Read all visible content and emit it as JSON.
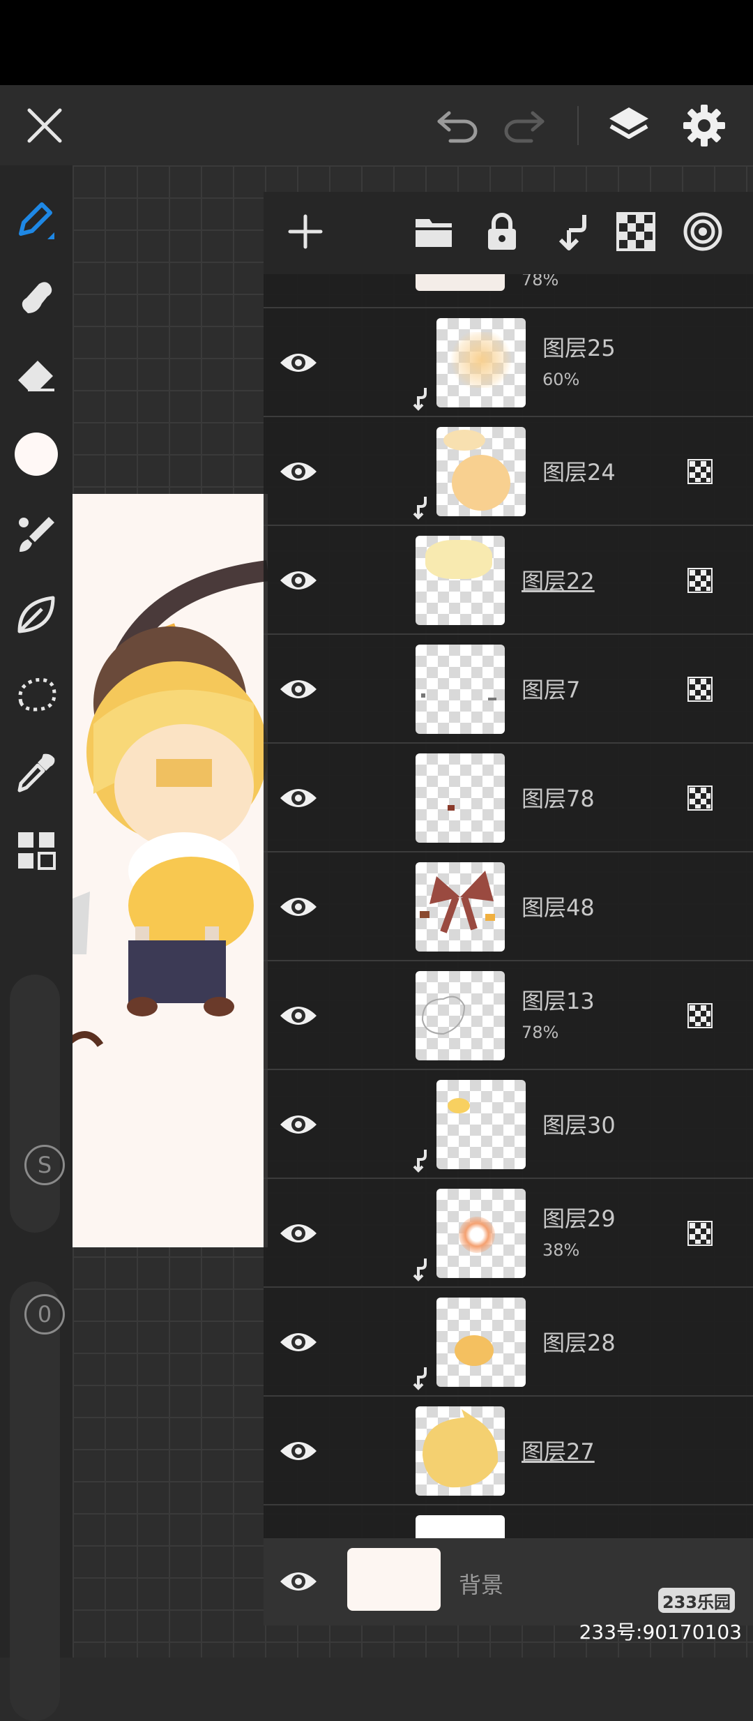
{
  "layers": [
    {
      "name": "",
      "opacity": "78%"
    },
    {
      "name": "图层25",
      "opacity": "60%"
    },
    {
      "name": "图层24",
      "opacity": ""
    },
    {
      "name": "图层22",
      "opacity": ""
    },
    {
      "name": "图层7",
      "opacity": ""
    },
    {
      "name": "图层78",
      "opacity": ""
    },
    {
      "name": "图层48",
      "opacity": ""
    },
    {
      "name": "图层13",
      "opacity": "78%"
    },
    {
      "name": "图层30",
      "opacity": ""
    },
    {
      "name": "图层29",
      "opacity": "38%"
    },
    {
      "name": "图层28",
      "opacity": ""
    },
    {
      "name": "图层27",
      "opacity": ""
    }
  ],
  "background_layer": {
    "name": "背景"
  },
  "slider_labels": {
    "size": "S",
    "opacity": "0"
  },
  "watermark": "233号:90170103",
  "logo": "233乐园",
  "colors": {
    "accent": "#1e88e5",
    "current_color": "#fff8f6"
  }
}
